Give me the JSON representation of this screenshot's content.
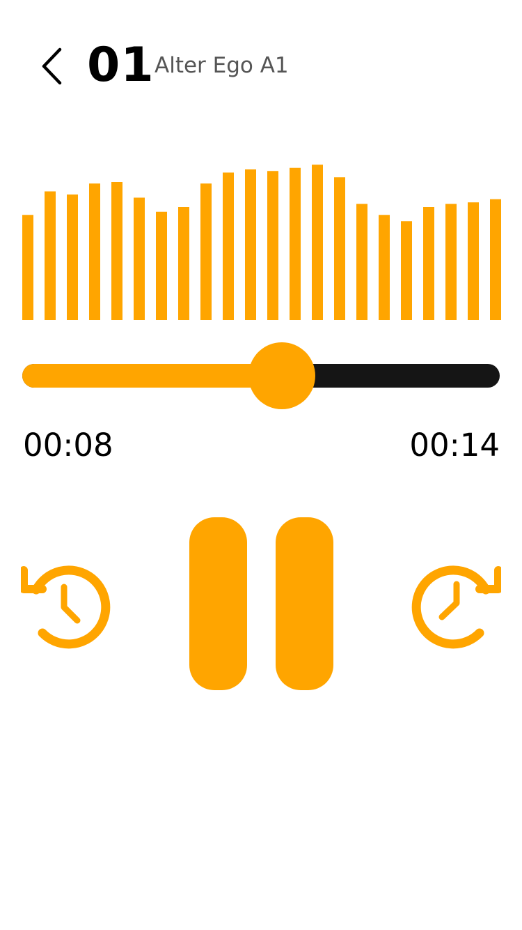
{
  "header": {
    "track_number": "01",
    "track_title": "Alter Ego A1"
  },
  "icons": {
    "back": "chevron-left-icon",
    "rewind": "history-rewind-icon",
    "forward": "clock-forward-icon",
    "pause": "pause-icon"
  },
  "colors": {
    "accent": "#FFA500",
    "track": "#151515",
    "text": "#000000",
    "subtitle": "#555555"
  },
  "waveform": {
    "levels": [
      0.67,
      0.82,
      0.8,
      0.87,
      0.88,
      0.78,
      0.69,
      0.72,
      0.87,
      0.94,
      0.96,
      0.95,
      0.97,
      0.99,
      0.91,
      0.74,
      0.67,
      0.63,
      0.72,
      0.74,
      0.75,
      0.77
    ]
  },
  "player": {
    "elapsed": "00:08",
    "total": "00:14",
    "progress": 0.544
  }
}
